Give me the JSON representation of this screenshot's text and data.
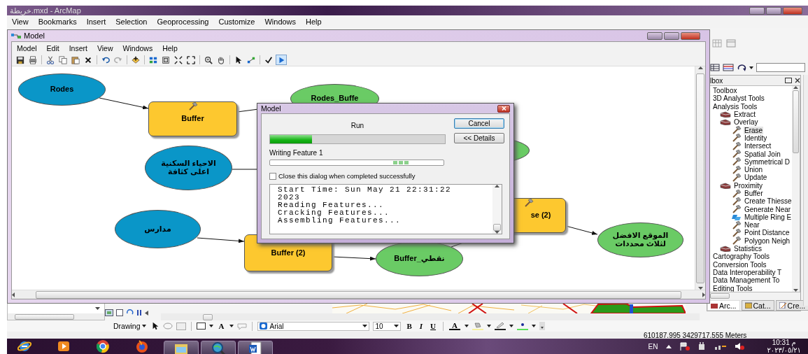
{
  "app": {
    "title": "خريطة.mxd - ArcMap",
    "menu": [
      "View",
      "Bookmarks",
      "Insert",
      "Selection",
      "Geoprocessing",
      "Customize",
      "Windows",
      "Help"
    ]
  },
  "model_window": {
    "title": "Model",
    "menu": [
      "Model",
      "Edit",
      "Insert",
      "View",
      "Windows",
      "Help"
    ],
    "toolbar": [
      {
        "selected": false
      },
      {
        "selected": false
      },
      {
        "selected": false
      },
      {
        "selected": false
      },
      {
        "selected": false
      },
      {
        "selected": false
      },
      {
        "selected": false
      },
      {
        "selected": false
      },
      {
        "selected": false
      },
      {
        "selected": false
      },
      {
        "selected": false
      },
      {
        "selected": false
      },
      {
        "selected": false
      },
      {
        "selected": false
      },
      {
        "selected": false
      },
      {
        "selected": false
      },
      {
        "selected": false
      },
      {
        "selected": false
      },
      {
        "selected": true
      }
    ]
  },
  "diagram": {
    "nodes": [
      {
        "kind": "input",
        "label": "Rodes"
      },
      {
        "kind": "tool",
        "label": "Buffer",
        "tool_icon": true
      },
      {
        "kind": "output",
        "label": "Rodes_Buffe"
      },
      {
        "kind": "output"
      },
      {
        "kind": "input",
        "label": "الاحياء السكنية اعلى كثافة"
      },
      {
        "kind": "input",
        "label": "مدارس"
      },
      {
        "kind": "tool",
        "label": "Buffer (2)",
        "tool_icon": false
      },
      {
        "kind": "output",
        "label": "نقطي_Buffer"
      },
      {
        "kind": "tool",
        "label": "se (2)",
        "tool_icon": true
      },
      {
        "kind": "output",
        "label": "الموقع الافضل لثلاث محددات"
      }
    ]
  },
  "dialog": {
    "title": "Model",
    "status": "Run",
    "progress": {
      "level": 0.24
    },
    "buttons": [
      {
        "label": "Cancel",
        "default": true
      },
      {
        "label": "<< Details",
        "default": false
      }
    ],
    "feature_label": "Writing Feature 1",
    "close_when_done": {
      "label": "Close this dialog when completed successfully",
      "checked": false
    },
    "log": [
      "Start Time: Sun May 21 22:31:22 2023",
      "Reading Features...",
      "Cracking Features...",
      "Assembling Features..."
    ]
  },
  "toolbox": {
    "title": "lbox",
    "tree": [
      {
        "kind": "toolbox",
        "label": "Toolbox",
        "selected": false
      },
      {
        "kind": "toolbox",
        "label": "3D Analyst Tools",
        "selected": false
      },
      {
        "kind": "toolbox",
        "label": "Analysis Tools",
        "selected": false,
        "children": [
          {
            "kind": "toolset",
            "label": "Extract",
            "selected": false
          },
          {
            "kind": "toolset",
            "label": "Overlay",
            "selected": false,
            "children": [
              {
                "kind": "tool",
                "label": "Erase",
                "selected": true
              },
              {
                "kind": "tool",
                "label": "Identity",
                "selected": false
              },
              {
                "kind": "tool",
                "label": "Intersect",
                "selected": false
              },
              {
                "kind": "tool",
                "label": "Spatial Join",
                "selected": false
              },
              {
                "kind": "tool",
                "label": "Symmetrical D",
                "selected": false
              },
              {
                "kind": "tool",
                "label": "Union",
                "selected": false
              },
              {
                "kind": "tool",
                "label": "Update",
                "selected": false
              }
            ]
          },
          {
            "kind": "toolset",
            "label": "Proximity",
            "selected": false,
            "children": [
              {
                "kind": "tool",
                "label": "Buffer",
                "selected": false
              },
              {
                "kind": "tool",
                "label": "Create Thiesse",
                "selected": false
              },
              {
                "kind": "tool",
                "label": "Generate Near",
                "selected": false
              },
              {
                "kind": "model",
                "label": "Multiple Ring E",
                "selected": false
              },
              {
                "kind": "tool",
                "label": "Near",
                "selected": false
              },
              {
                "kind": "tool",
                "label": "Point Distance",
                "selected": false
              },
              {
                "kind": "tool",
                "label": "Polygon Neigh",
                "selected": false
              }
            ]
          },
          {
            "kind": "toolset",
            "label": "Statistics",
            "selected": false
          }
        ]
      },
      {
        "kind": "toolbox",
        "label": "Cartography Tools",
        "selected": false
      },
      {
        "kind": "toolbox",
        "label": "Conversion Tools",
        "selected": false
      },
      {
        "kind": "toolbox",
        "label": "Data Interoperability T",
        "selected": false
      },
      {
        "kind": "toolbox",
        "label": "Data Management To",
        "selected": false
      },
      {
        "kind": "toolbox",
        "label": "Editing Tools",
        "selected": false
      }
    ],
    "tabs": [
      {
        "label": "Arc...",
        "selected": true
      },
      {
        "label": "Cat...",
        "selected": false
      },
      {
        "label": "Cre...",
        "selected": false
      }
    ]
  },
  "drawing_toolbar": {
    "menu": "Drawing",
    "text_tool": "A",
    "font": "Arial",
    "size": "10",
    "bold": "B",
    "italic": "I",
    "underline": "U",
    "font_color": "A"
  },
  "status_bar": {
    "coordinates": "610187.995  3429717.555 Meters"
  },
  "taskbar": {
    "buttons": [
      {
        "running": false
      },
      {
        "running": false
      },
      {
        "running": false
      },
      {
        "running": false
      },
      {
        "running": true
      },
      {
        "running": true
      },
      {
        "running": true
      }
    ],
    "language": "EN",
    "time": "10:31 م",
    "date": "٢٠٢٣/٠٥/٢١"
  }
}
